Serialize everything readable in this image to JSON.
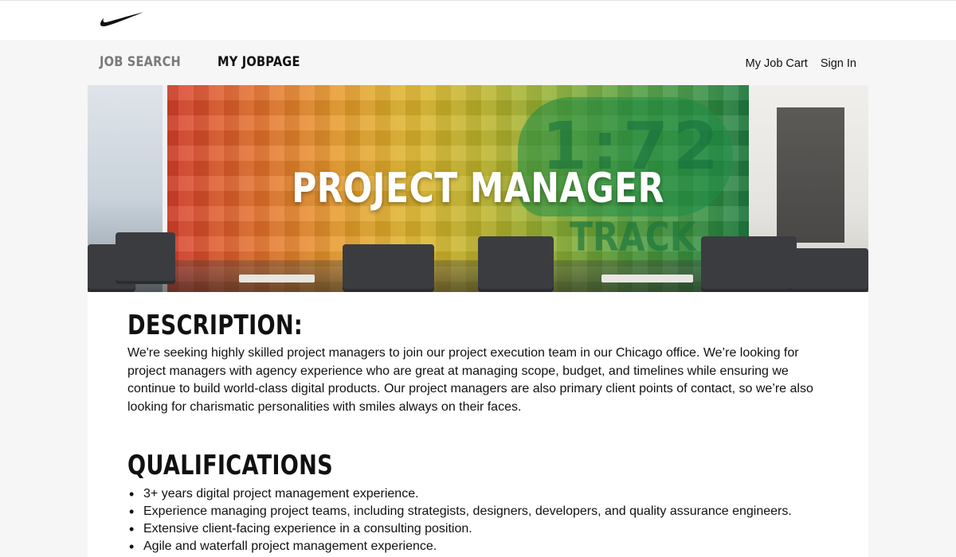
{
  "brand": {
    "logo": "nike-swoosh-icon"
  },
  "nav": {
    "job_search": "JOB SEARCH",
    "my_jobpage": "MY JOBPAGE",
    "job_cart": "My Job Cart",
    "sign_in": "Sign In"
  },
  "hero": {
    "title": "PROJECT MANAGER",
    "mural_number": "1:72",
    "mural_word": "TRACK"
  },
  "description": {
    "heading": "DESCRIPTION:",
    "body": "We're seeking highly skilled project managers to join our project execution team in our Chicago office. We’re looking for project managers with agency experience who are great at managing scope, budget, and timelines while ensuring we continue to build world-class digital products. Our project managers are also primary client points of contact, so we’re also looking for charismatic personalities with smiles always on their faces."
  },
  "qualifications": {
    "heading": "QUALIFICATIONS",
    "items": [
      "3+ years digital project management experience.",
      "Experience managing project teams, including strategists, designers, developers, and quality assurance engineers.",
      "Extensive client-facing experience in a consulting position.",
      "Agile and waterfall project management experience."
    ]
  },
  "colors": {
    "accent_active": "#111111",
    "nav_inactive": "#7a7a7a",
    "page_bg": "#f6f6f6"
  }
}
